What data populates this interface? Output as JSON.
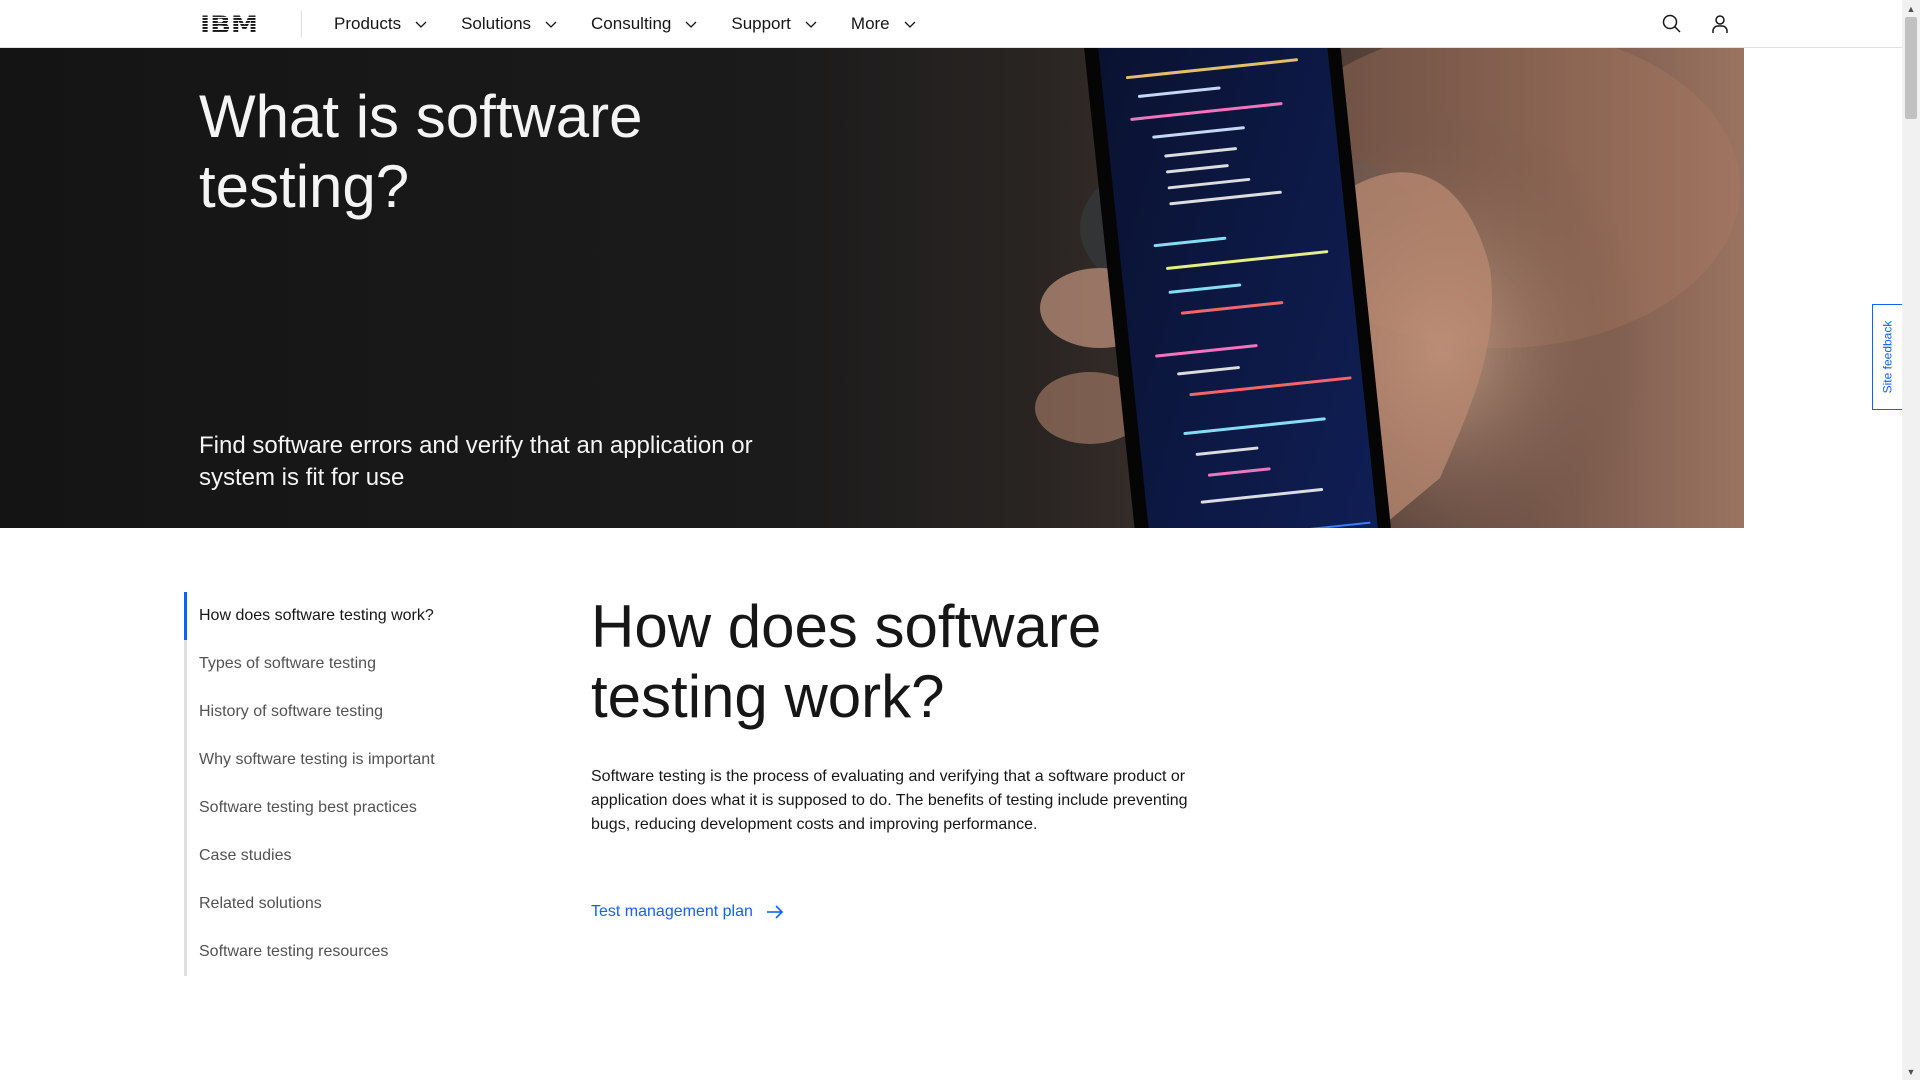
{
  "masthead": {
    "logo_text": "IBM",
    "nav": [
      {
        "label": "Products"
      },
      {
        "label": "Solutions"
      },
      {
        "label": "Consulting"
      },
      {
        "label": "Support"
      },
      {
        "label": "More"
      }
    ],
    "icons": {
      "search": "search-icon",
      "user": "user-icon",
      "chevron": "chevron-down-icon"
    }
  },
  "hero": {
    "title": "What is software testing?",
    "subtitle": "Find software errors and verify that an application or system is fit for use"
  },
  "toc": {
    "items": [
      {
        "label": "How does software testing work?",
        "active": true
      },
      {
        "label": "Types of software testing",
        "active": false
      },
      {
        "label": "History of software testing",
        "active": false
      },
      {
        "label": "Why software testing is important",
        "active": false
      },
      {
        "label": "Software testing best practices",
        "active": false
      },
      {
        "label": "Case studies",
        "active": false
      },
      {
        "label": "Related solutions",
        "active": false
      },
      {
        "label": "Software testing resources",
        "active": false
      }
    ]
  },
  "main": {
    "heading": "How does software testing work?",
    "body": "Software testing is the process of evaluating and verifying that a software product or application does what it is supposed to do. The benefits of testing include preventing bugs, reducing development costs and improving performance.",
    "link_label": "Test management plan",
    "link_icon": "arrow-right-icon"
  },
  "feedback": {
    "label": "Site feedback"
  },
  "colors": {
    "accent": "#0f62fe",
    "text": "#161616",
    "secondary_text": "#525252",
    "hero_bg": "#161616"
  }
}
